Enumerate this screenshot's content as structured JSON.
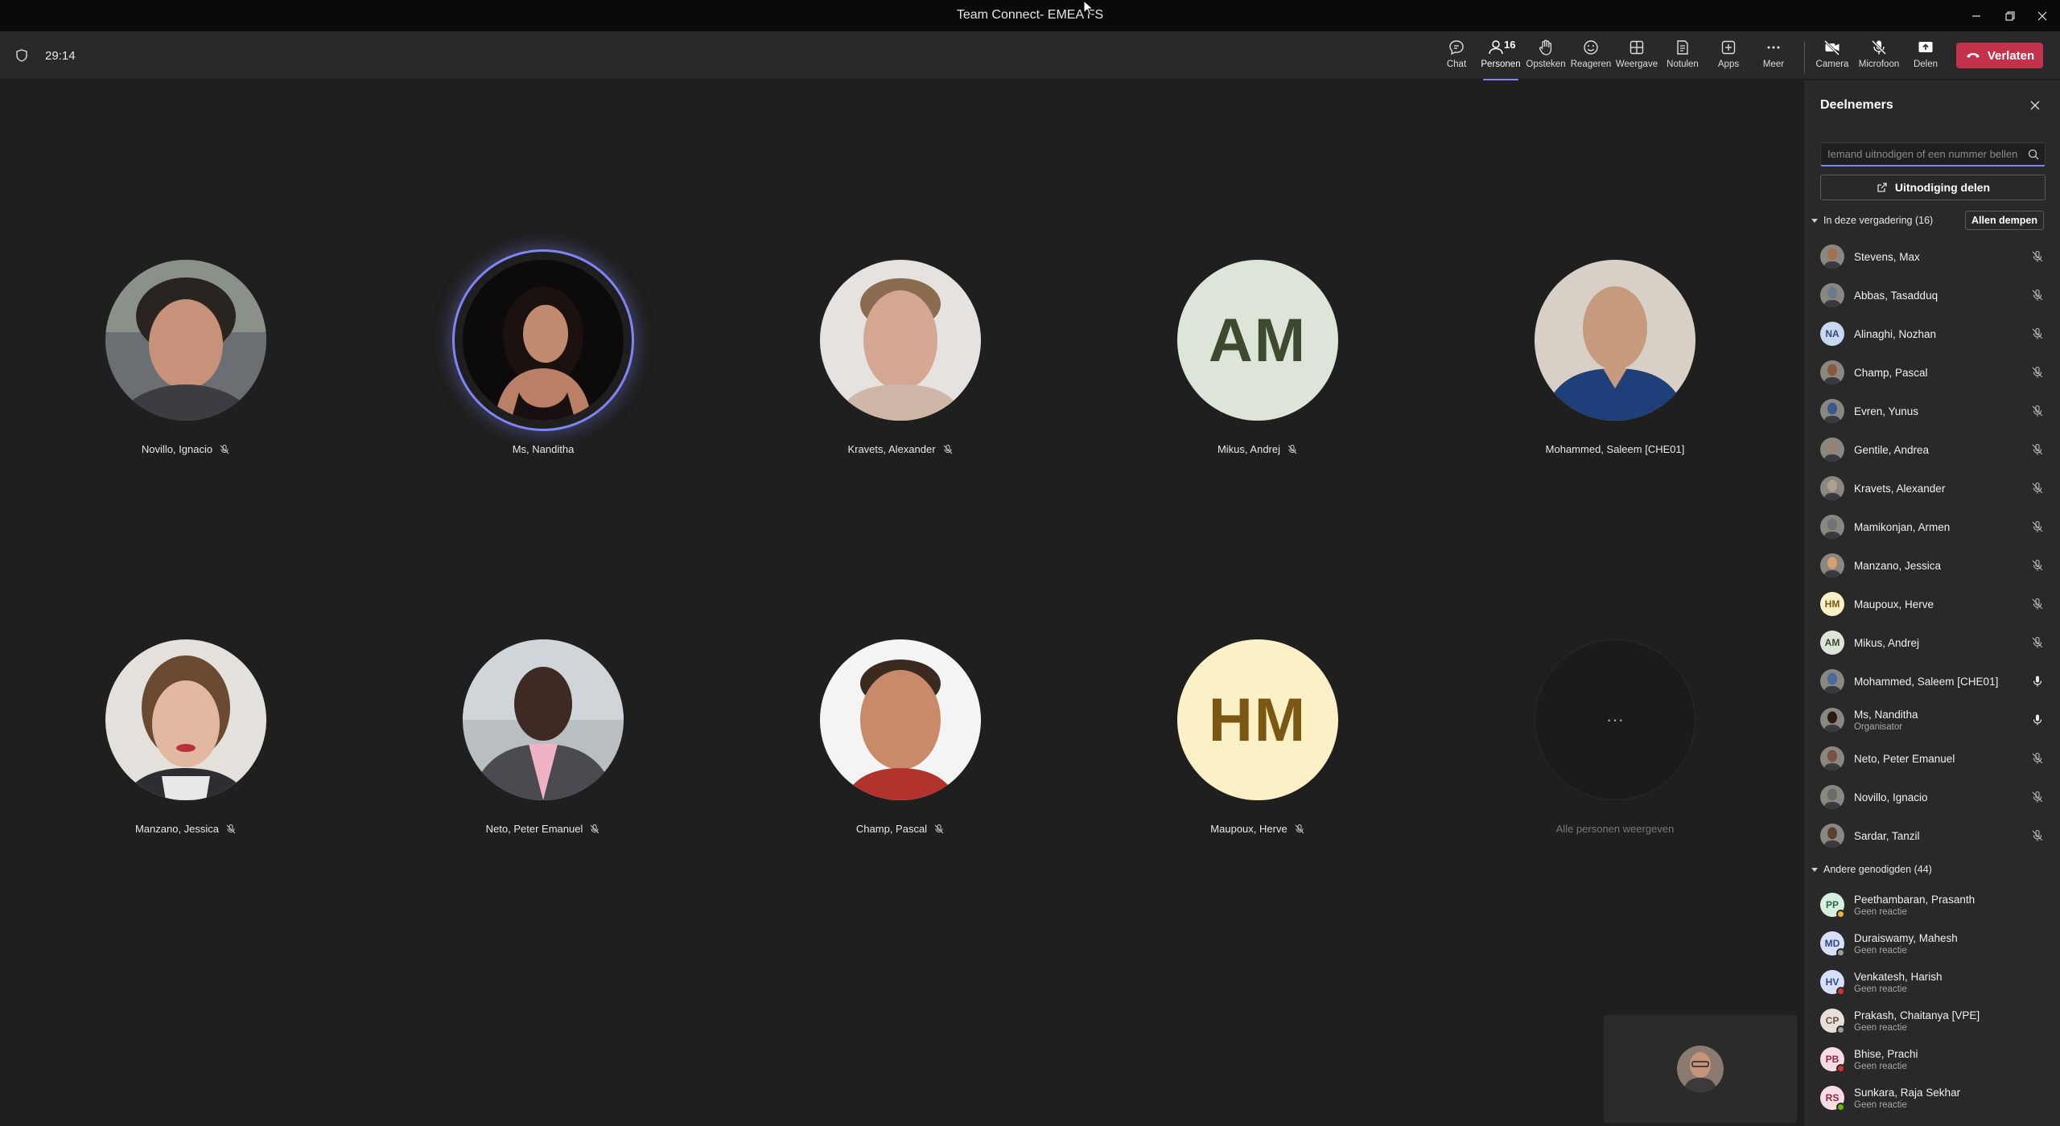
{
  "window": {
    "title": "Team Connect- EMEA FS"
  },
  "toolbar": {
    "timer": "29:14",
    "people_count": "16",
    "buttons": {
      "chat": "Chat",
      "people": "Personen",
      "raise": "Opsteken",
      "react": "Reageren",
      "view": "Weergave",
      "notes": "Notulen",
      "apps": "Apps",
      "more": "Meer",
      "camera": "Camera",
      "mic": "Microfoon",
      "share": "Delen"
    },
    "leave": "Verlaten"
  },
  "colors": {
    "accent": "#7f85f5",
    "leave": "#c4314b",
    "background": "#1f1f1f",
    "panel": "#292929"
  },
  "stage": {
    "tiles": [
      {
        "name": "Novillo, Ignacio",
        "muted": true
      },
      {
        "name": "Ms, Nanditha",
        "muted": false,
        "speaking": true
      },
      {
        "name": "Kravets, Alexander",
        "muted": true
      },
      {
        "name": "Mikus, Andrej",
        "muted": true,
        "initials": "AM"
      },
      {
        "name": "Mohammed, Saleem [CHE01]",
        "muted": false
      },
      {
        "name": "Manzano, Jessica",
        "muted": true
      },
      {
        "name": "Neto, Peter Emanuel",
        "muted": true
      },
      {
        "name": "Champ, Pascal",
        "muted": true
      },
      {
        "name": "Maupoux, Herve",
        "muted": true,
        "initials": "HM"
      },
      {
        "name": "Alle personen weergeven",
        "more": "···"
      }
    ]
  },
  "panel": {
    "title": "Deelnemers",
    "search_placeholder": "Iemand uitnodigen of een nummer bellen",
    "invite": "Uitnodiging delen",
    "in_meeting_label": "In deze vergadering (16)",
    "mute_all": "Allen dempen",
    "in_meeting": [
      {
        "name": "Stevens, Max",
        "mic": "muted"
      },
      {
        "name": "Abbas, Tasadduq",
        "mic": "muted"
      },
      {
        "name": "Alinaghi, Nozhan",
        "initials": "NA",
        "mic": "muted"
      },
      {
        "name": "Champ, Pascal",
        "mic": "muted"
      },
      {
        "name": "Evren, Yunus",
        "mic": "muted"
      },
      {
        "name": "Gentile, Andrea",
        "mic": "muted"
      },
      {
        "name": "Kravets, Alexander",
        "mic": "muted"
      },
      {
        "name": "Mamikonjan, Armen",
        "mic": "muted"
      },
      {
        "name": "Manzano, Jessica",
        "mic": "muted"
      },
      {
        "name": "Maupoux, Herve",
        "initials": "HM",
        "mic": "muted"
      },
      {
        "name": "Mikus, Andrej",
        "initials": "AM",
        "mic": "muted"
      },
      {
        "name": "Mohammed, Saleem [CHE01]",
        "mic": "on"
      },
      {
        "name": "Ms, Nanditha",
        "sub": "Organisator",
        "mic": "on"
      },
      {
        "name": "Neto, Peter Emanuel",
        "mic": "muted"
      },
      {
        "name": "Novillo, Ignacio",
        "mic": "muted"
      },
      {
        "name": "Sardar, Tanzil",
        "mic": "muted"
      }
    ],
    "others_label": "Andere genodigden (44)",
    "others": [
      {
        "name": "Peethambaran, Prasanth",
        "sub": "Geen reactie",
        "initials": "PP"
      },
      {
        "name": "Duraiswamy, Mahesh",
        "sub": "Geen reactie",
        "initials": "MD"
      },
      {
        "name": "Venkatesh, Harish",
        "sub": "Geen reactie",
        "initials": "HV"
      },
      {
        "name": "Prakash, Chaitanya [VPE]",
        "sub": "Geen reactie",
        "initials": "CP"
      },
      {
        "name": "Bhise, Prachi",
        "sub": "Geen reactie",
        "initials": "PB"
      },
      {
        "name": "Sunkara, Raja Sekhar",
        "sub": "Geen reactie",
        "initials": "RS"
      }
    ]
  }
}
